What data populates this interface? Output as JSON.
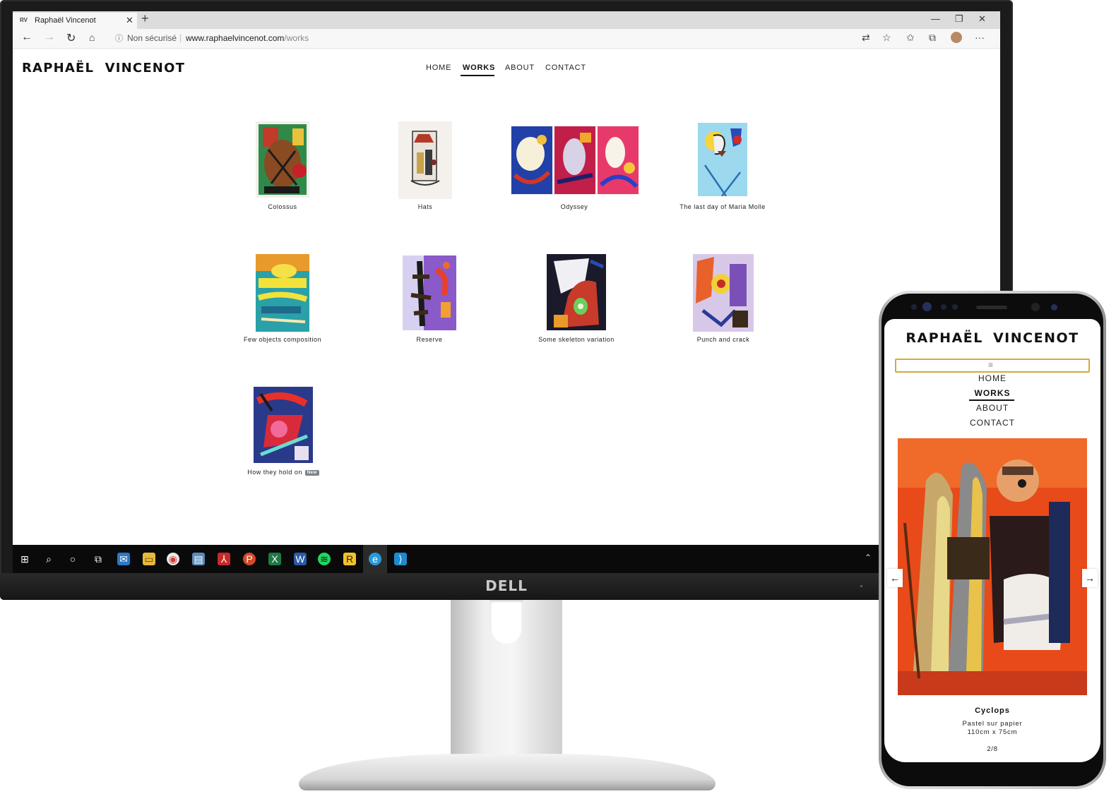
{
  "browser": {
    "tab_title": "Raphaël Vincenot",
    "tab_favicon": "RV",
    "new_tab": "+",
    "security_label": "Non sécurisé",
    "url_host": "www.raphaelvincenot.com",
    "url_path": "/works"
  },
  "site": {
    "logo": "RAPHAËL VINCENOT",
    "nav": [
      "HOME",
      "WORKS",
      "ABOUT",
      "CONTACT"
    ],
    "active_nav": "WORKS",
    "works": [
      {
        "title": "Colossus"
      },
      {
        "title": "Hats"
      },
      {
        "title": "Odyssey"
      },
      {
        "title": "The last day of Maria Molle"
      },
      {
        "title": "Few objects composition"
      },
      {
        "title": "Reserve"
      },
      {
        "title": "Some skeleton variation"
      },
      {
        "title": "Punch and crack"
      },
      {
        "title": "How they hold on",
        "badge": "New"
      }
    ]
  },
  "monitor": {
    "brand": "DELL"
  },
  "mobile": {
    "logo": "RAPHAËL VINCENOT",
    "nav": [
      "HOME",
      "WORKS",
      "ABOUT",
      "CONTACT"
    ],
    "active_nav": "WORKS",
    "artwork": {
      "title": "Cyclops",
      "medium": "Pastel sur papier",
      "size": "110cm x 75cm",
      "counter": "2/8"
    }
  },
  "colors": {
    "menu_toggle_border": "#d8a93a",
    "new_badge": "#7d8388",
    "taskbar": "#0a0a0a"
  }
}
